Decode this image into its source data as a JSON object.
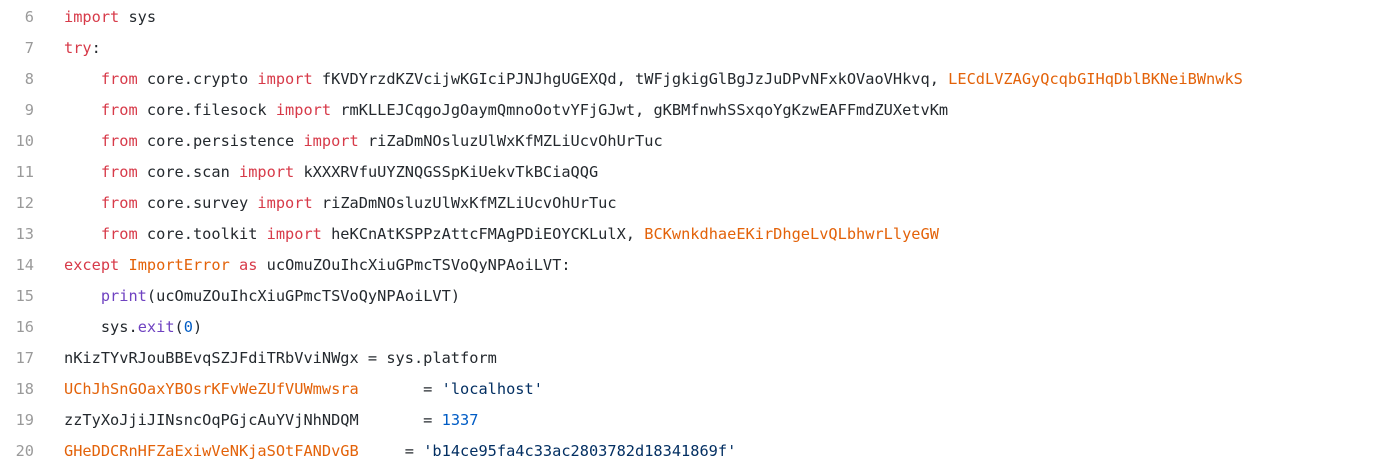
{
  "editor": {
    "lines": [
      {
        "n": "6",
        "indent": "",
        "tokens": [
          {
            "t": "import",
            "c": "kw"
          },
          {
            "t": " sys",
            "c": "pl"
          }
        ]
      },
      {
        "n": "7",
        "indent": "",
        "tokens": [
          {
            "t": "try",
            "c": "kw"
          },
          {
            "t": ":",
            "c": "pl"
          }
        ]
      },
      {
        "n": "8",
        "indent": "    ",
        "tokens": [
          {
            "t": "from",
            "c": "kw"
          },
          {
            "t": " core.crypto ",
            "c": "pl"
          },
          {
            "t": "import",
            "c": "kw"
          },
          {
            "t": " fKVDYrzdKZVcijwKGIciPJNJhgUGEXQd, tWFjgkigGlBgJzJuDPvNFxkOVaoVHkvq, ",
            "c": "pl"
          },
          {
            "t": "LECdLVZAGyQcqbGIHqDblBKNeiBWnwkS",
            "c": "og"
          }
        ]
      },
      {
        "n": "9",
        "indent": "    ",
        "tokens": [
          {
            "t": "from",
            "c": "kw"
          },
          {
            "t": " core.filesock ",
            "c": "pl"
          },
          {
            "t": "import",
            "c": "kw"
          },
          {
            "t": " rmKLLEJCqgoJgOaymQmnoOotvYFjGJwt, gKBMfnwhSSxqoYgKzwEAFFmdZUXetvKm",
            "c": "pl"
          }
        ]
      },
      {
        "n": "10",
        "indent": "    ",
        "tokens": [
          {
            "t": "from",
            "c": "kw"
          },
          {
            "t": " core.persistence ",
            "c": "pl"
          },
          {
            "t": "import",
            "c": "kw"
          },
          {
            "t": " riZaDmNOsluzUlWxKfMZLiUcvOhUrTuc",
            "c": "pl"
          }
        ]
      },
      {
        "n": "11",
        "indent": "    ",
        "tokens": [
          {
            "t": "from",
            "c": "kw"
          },
          {
            "t": " core.scan ",
            "c": "pl"
          },
          {
            "t": "import",
            "c": "kw"
          },
          {
            "t": " kXXXRVfuUYZNQGSSpKiUekvTkBCiaQQG",
            "c": "pl"
          }
        ]
      },
      {
        "n": "12",
        "indent": "    ",
        "tokens": [
          {
            "t": "from",
            "c": "kw"
          },
          {
            "t": " core.survey ",
            "c": "pl"
          },
          {
            "t": "import",
            "c": "kw"
          },
          {
            "t": " riZaDmNOsluzUlWxKfMZLiUcvOhUrTuc",
            "c": "pl"
          }
        ]
      },
      {
        "n": "13",
        "indent": "    ",
        "tokens": [
          {
            "t": "from",
            "c": "kw"
          },
          {
            "t": " core.toolkit ",
            "c": "pl"
          },
          {
            "t": "import",
            "c": "kw"
          },
          {
            "t": " heKCnAtKSPPzAttcFMAgPDiEOYCKLulX, ",
            "c": "pl"
          },
          {
            "t": "BCKwnkdhaeEKirDhgeLvQLbhwrLlyeGW",
            "c": "og"
          }
        ]
      },
      {
        "n": "14",
        "indent": "",
        "tokens": [
          {
            "t": "except",
            "c": "kw"
          },
          {
            "t": " ",
            "c": "pl"
          },
          {
            "t": "ImportError",
            "c": "og"
          },
          {
            "t": " ",
            "c": "pl"
          },
          {
            "t": "as",
            "c": "kw"
          },
          {
            "t": " ucOmuZOuIhcXiuGPmcTSVoQyNPAoiLVT:",
            "c": "pl"
          }
        ]
      },
      {
        "n": "15",
        "indent": "    ",
        "tokens": [
          {
            "t": "print",
            "c": "fn"
          },
          {
            "t": "(ucOmuZOuIhcXiuGPmcTSVoQyNPAoiLVT)",
            "c": "pl"
          }
        ]
      },
      {
        "n": "16",
        "indent": "    ",
        "tokens": [
          {
            "t": "sys.",
            "c": "pl"
          },
          {
            "t": "exit",
            "c": "fn"
          },
          {
            "t": "(",
            "c": "pl"
          },
          {
            "t": "0",
            "c": "nm"
          },
          {
            "t": ")",
            "c": "pl"
          }
        ]
      },
      {
        "n": "17",
        "indent": "",
        "tokens": [
          {
            "t": "nKizTYvRJouBBEvqSZJFdiTRbVviNWgx = sys.platform",
            "c": "pl"
          }
        ]
      },
      {
        "n": "18",
        "indent": "",
        "tokens": [
          {
            "t": "UChJhSnGOaxYBOsrKFvWeZUfVUWmwsra",
            "c": "og"
          },
          {
            "t": "       = ",
            "c": "pl"
          },
          {
            "t": "'localhost'",
            "c": "st"
          }
        ]
      },
      {
        "n": "19",
        "indent": "",
        "tokens": [
          {
            "t": "zzTyXoJjiJINsncOqPGjcAuYVjNhNDQM",
            "c": "pl"
          },
          {
            "t": "       = ",
            "c": "pl"
          },
          {
            "t": "1337",
            "c": "nm"
          }
        ]
      },
      {
        "n": "20",
        "indent": "",
        "tokens": [
          {
            "t": "GHeDDCRnHFZaExiwVeNKjaSOtFANDvGB",
            "c": "og"
          },
          {
            "t": "     = ",
            "c": "pl"
          },
          {
            "t": "'b14ce95fa4c33ac2803782d18341869f'",
            "c": "st"
          }
        ]
      }
    ]
  }
}
